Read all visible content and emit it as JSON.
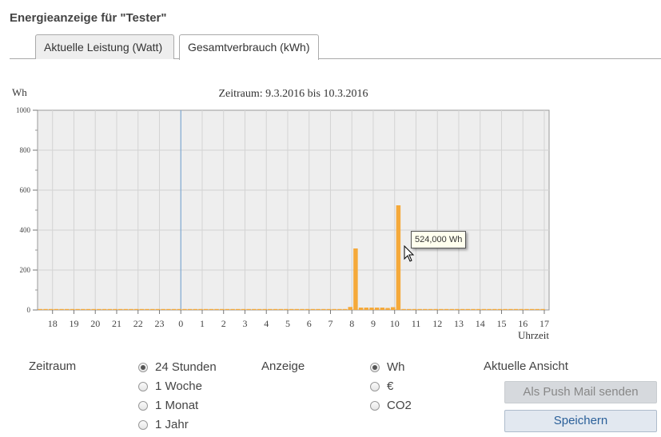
{
  "page_title": "Energieanzeige für \"Tester\"",
  "tabs": [
    {
      "label": "Aktuelle Leistung (Watt)",
      "active": false
    },
    {
      "label": "Gesamtverbrauch (kWh)",
      "active": true
    }
  ],
  "chart_data": {
    "type": "bar",
    "title": "Zeitraum: 9.3.2016 bis 10.3.2016",
    "ylabel": "Wh",
    "xlabel": "Uhrzeit",
    "ylim": [
      0,
      1000
    ],
    "yticks": [
      "0",
      "200",
      "400",
      "600",
      "800",
      "1000"
    ],
    "xticks": [
      "18",
      "19",
      "20",
      "21",
      "22",
      "23",
      "0",
      "1",
      "2",
      "3",
      "4",
      "5",
      "6",
      "7",
      "8",
      "9",
      "10",
      "11",
      "12",
      "13",
      "14",
      "15",
      "16",
      "17"
    ],
    "x_start_hour": 17.3,
    "bin_hours": 0.25,
    "values": [
      2,
      2,
      2,
      2,
      2,
      2,
      2,
      2,
      2,
      2,
      2,
      2,
      2,
      2,
      2,
      2,
      2,
      2,
      2,
      2,
      2,
      2,
      2,
      2,
      2,
      2,
      2,
      2,
      2,
      2,
      2,
      2,
      2,
      2,
      2,
      2,
      2,
      2,
      2,
      2,
      2,
      2,
      2,
      2,
      2,
      2,
      2,
      2,
      2,
      2,
      2,
      2,
      2,
      2,
      2,
      2,
      2,
      2,
      2,
      2,
      2,
      2,
      2,
      2,
      2,
      2,
      2,
      2,
      2,
      2,
      2,
      2,
      2,
      2,
      2,
      2,
      2,
      2,
      2,
      2,
      2,
      2,
      2,
      2,
      2,
      2,
      2,
      2,
      2,
      2,
      2,
      2,
      2,
      2,
      2,
      2,
      2,
      2,
      2,
      2,
      2,
      2,
      2,
      2,
      2,
      2,
      2,
      2,
      2,
      2,
      2,
      2,
      2,
      2,
      2,
      2,
      2,
      2,
      2,
      2,
      2,
      2,
      2,
      2,
      2,
      2,
      2,
      2,
      2,
      2,
      2,
      2,
      2,
      2,
      2,
      2,
      2,
      2,
      2,
      2,
      2,
      2,
      2,
      2,
      2,
      2,
      2,
      2,
      2,
      2,
      2,
      2,
      2,
      2,
      2,
      2,
      2,
      2,
      2,
      2,
      2,
      2,
      2,
      2,
      2,
      2,
      2,
      2,
      2,
      2,
      2,
      2,
      2,
      2,
      2,
      2,
      2,
      2,
      2,
      2,
      2,
      2,
      2,
      2,
      2,
      2,
      2,
      2,
      2,
      2,
      2,
      2,
      2,
      2,
      2,
      2,
      2,
      2,
      2,
      2,
      2,
      2,
      2,
      2,
      2,
      2,
      2,
      2,
      2,
      2,
      2,
      2,
      2,
      2,
      2,
      2,
      2,
      2,
      2,
      2,
      2,
      2,
      2,
      2,
      2,
      2,
      2,
      2,
      2,
      2,
      2,
      2,
      2,
      2,
      2,
      2,
      2,
      2,
      2,
      2,
      2,
      2,
      2,
      2,
      2,
      2,
      2,
      2,
      2,
      2,
      2,
      2,
      2,
      2,
      2,
      2,
      2,
      2,
      2,
      2,
      2,
      2,
      2,
      2,
      2,
      2,
      2,
      2,
      2,
      2,
      2,
      2,
      2,
      2,
      2,
      2,
      2,
      2,
      2,
      2,
      2,
      2,
      2,
      2,
      2,
      2,
      2,
      2,
      2,
      2,
      2
    ],
    "highlight_values": {
      "58": 15,
      "59": 308,
      "60": 12,
      "61": 12,
      "62": 12,
      "63": 12,
      "64": 12,
      "65": 10,
      "66": 14,
      "67": 524
    },
    "series_color": "#f5a93a",
    "grid": true,
    "background": "#eeeeee",
    "marker_x_hour": 0
  },
  "tooltip": {
    "text": "524,000 Wh"
  },
  "controls": {
    "zeitraum": {
      "label": "Zeitraum",
      "options": [
        {
          "label": "24 Stunden",
          "checked": true
        },
        {
          "label": "1 Woche",
          "checked": false
        },
        {
          "label": "1 Monat",
          "checked": false
        },
        {
          "label": "1 Jahr",
          "checked": false
        }
      ]
    },
    "anzeige": {
      "label": "Anzeige",
      "options": [
        {
          "label": "Wh",
          "checked": true
        },
        {
          "label": "€",
          "checked": false
        },
        {
          "label": "CO2",
          "checked": false
        }
      ]
    },
    "aktuelle_ansicht": {
      "label": "Aktuelle Ansicht",
      "push_mail_button": "Als Push Mail senden",
      "save_button": "Speichern"
    }
  }
}
